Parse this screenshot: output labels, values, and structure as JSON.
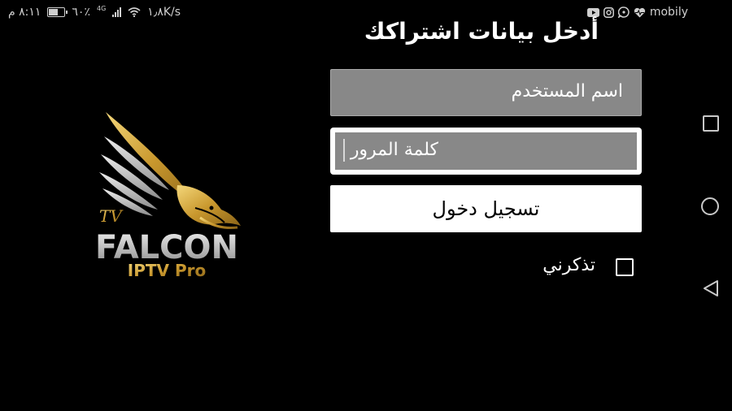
{
  "status_bar": {
    "time": "٨:١١ م",
    "battery_percent": "٦٠٪",
    "network_type": "4G",
    "speed": "١٫٨K/s",
    "carrier": "mobily",
    "icons": [
      "battery-icon",
      "signal-icon",
      "wifi-icon",
      "youtube-icon",
      "instagram-icon",
      "whatsapp-icon",
      "heart-pulse-icon"
    ]
  },
  "logo": {
    "small_text": "TV",
    "brand": "FALCON",
    "tagline": "IPTV Pro",
    "colors": {
      "gold": "#d9b54a",
      "silver": "#bdbdbd"
    }
  },
  "form": {
    "title": "أدخل بيانات اشتراكك",
    "username_placeholder": "اسم المستخدم",
    "password_placeholder": "كلمة  المرور",
    "login_label": "تسجيل دخول",
    "remember_label": "تذكرني",
    "remember_checked": false
  },
  "nav_bar": {
    "buttons": [
      "recent-apps-icon",
      "home-icon",
      "back-icon"
    ]
  }
}
